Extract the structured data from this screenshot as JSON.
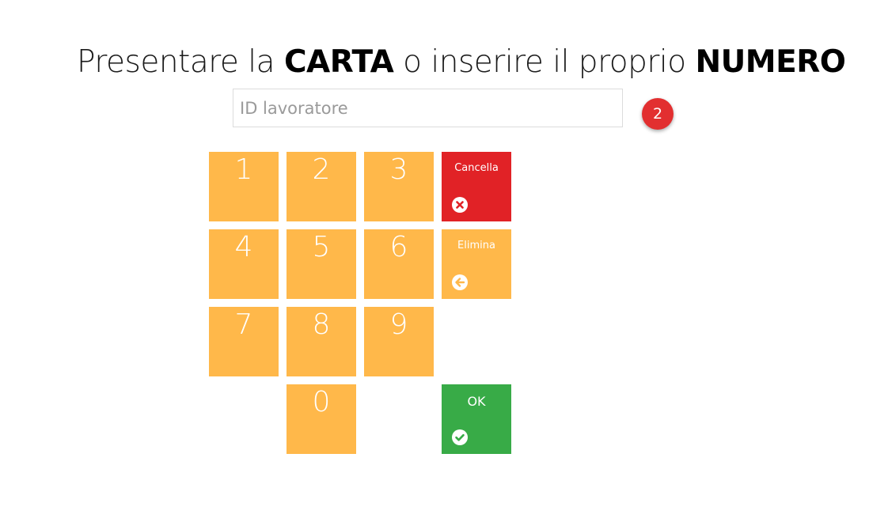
{
  "header": {
    "title_part1": "Presentare la ",
    "title_bold1": "CARTA",
    "title_part2": " o inserire il proprio ",
    "title_bold2": "NUMERO"
  },
  "input": {
    "placeholder": "ID lavoratore",
    "value": ""
  },
  "badge": {
    "count": "2",
    "color": "#e22f30"
  },
  "keypad": {
    "keys": [
      "1",
      "2",
      "3",
      "4",
      "5",
      "6",
      "7",
      "8",
      "9",
      "0"
    ],
    "key_color": "#ffb84a"
  },
  "actions": {
    "cancel": {
      "label": "Cancella",
      "icon": "close-circle-icon",
      "color": "#e12226"
    },
    "delete": {
      "label": "Elimina",
      "icon": "arrow-left-circle-icon",
      "color": "#ffb84a"
    },
    "ok": {
      "label": "OK",
      "icon": "check-circle-icon",
      "color": "#38ab47"
    }
  }
}
